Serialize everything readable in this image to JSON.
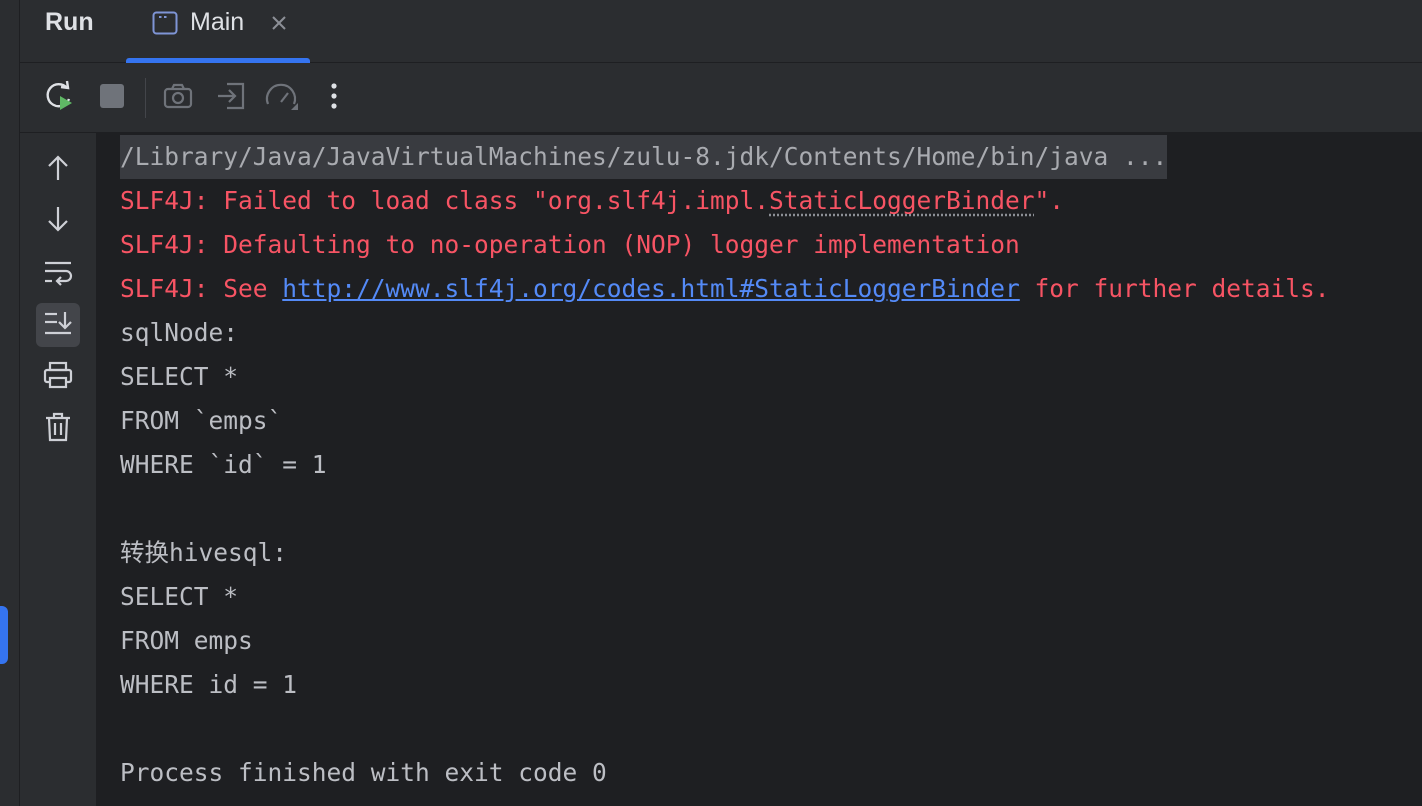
{
  "panel": {
    "title": "Run",
    "tab": {
      "label": "Main"
    }
  },
  "toolbar": {
    "buttons": [
      {
        "icon": "rerun-icon"
      },
      {
        "icon": "stop-icon"
      },
      {
        "icon": "camera-icon"
      },
      {
        "icon": "exit-icon"
      },
      {
        "icon": "profiler-icon"
      },
      {
        "icon": "more-options-icon"
      }
    ]
  },
  "sidebar": {
    "buttons": [
      {
        "icon": "arrow-up-icon"
      },
      {
        "icon": "arrow-down-icon"
      },
      {
        "icon": "soft-wrap-icon"
      },
      {
        "icon": "scroll-to-end-icon",
        "active": true
      },
      {
        "icon": "print-icon"
      },
      {
        "icon": "trash-icon"
      }
    ]
  },
  "console": {
    "command": "/Library/Java/JavaVirtualMachines/zulu-8.jdk/Contents/Home/bin/java ...",
    "err1_prefix": "SLF4J: Failed to load class \"org.slf4j.impl.",
    "err1_class": "StaticLoggerBinder",
    "err1_suffix": "\".",
    "err2": "SLF4J: Defaulting to no-operation (NOP) logger implementation",
    "err3_prefix": "SLF4J: See ",
    "err3_link": "http://www.slf4j.org/codes.html#StaticLoggerBinder",
    "err3_suffix": " for further details.",
    "lines": [
      "sqlNode:",
      "SELECT *",
      "FROM `emps`",
      "WHERE `id` = 1",
      "",
      "转换hivesql:",
      "SELECT *",
      "FROM emps",
      "WHERE id = 1",
      "",
      "Process finished with exit code 0"
    ]
  },
  "colors": {
    "accent": "#3574f0",
    "error": "#f75464",
    "link": "#548af7",
    "console_bg": "#1e1f22",
    "panel_bg": "#2b2d30"
  }
}
